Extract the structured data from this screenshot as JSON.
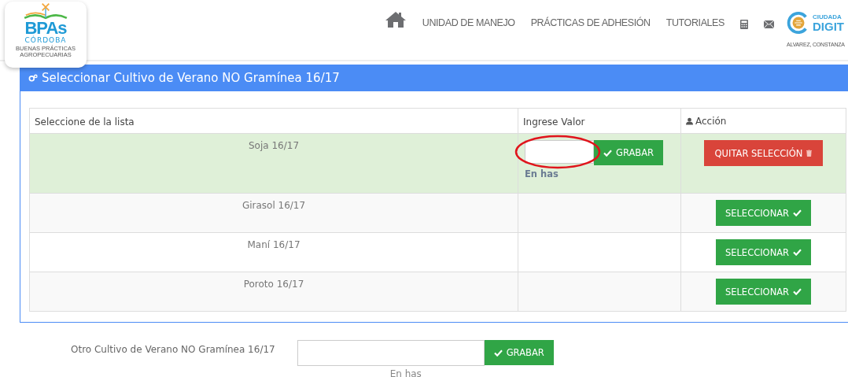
{
  "logo": {
    "title": "BPAs",
    "subtitle": "CÓRDOBA",
    "tagline": "BUENAS PRÁCTICAS AGROPECUARIAS"
  },
  "nav": {
    "items": [
      "UNIDAD DE MANEJO",
      "PRÁCTICAS DE ADHESIÓN",
      "TUTORIALES"
    ],
    "brand_top": "CIUDADA",
    "brand_main": "DIGIT",
    "user": "ALVAREZ, CONSTANZA"
  },
  "panel": {
    "title": "Seleccionar Cultivo de Verano NO Gramínea 16/17",
    "table": {
      "columns": [
        "Seleccione de la lista",
        "Ingrese Valor",
        "Acción"
      ],
      "rows": [
        {
          "crop": "Soja 16/17",
          "selected": true,
          "save_label": "GRABAR",
          "hint": "En has",
          "action": "QUITAR SELECCIÓN"
        },
        {
          "crop": "Girasol 16/17",
          "selected": false,
          "action": "SELECCIONAR"
        },
        {
          "crop": "Maní 16/17",
          "selected": false,
          "action": "SELECCIONAR"
        },
        {
          "crop": "Poroto 16/17",
          "selected": false,
          "action": "SELECCIONAR"
        }
      ]
    }
  },
  "other": {
    "label": "Otro Cultivo de Verano NO Gramínea 16/17",
    "save_label": "GRABAR",
    "hint": "En has"
  }
}
